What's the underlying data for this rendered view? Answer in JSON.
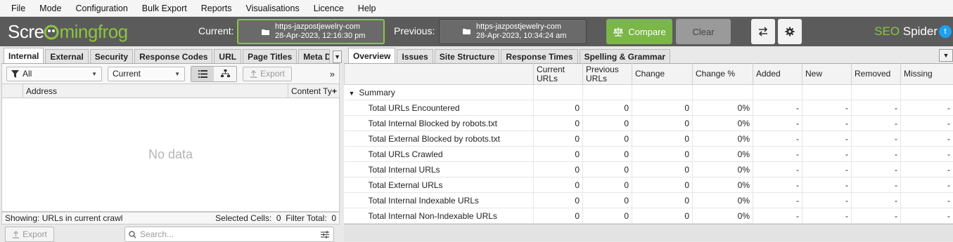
{
  "menu": [
    "File",
    "Mode",
    "Configuration",
    "Bulk Export",
    "Reports",
    "Visualisations",
    "Licence",
    "Help"
  ],
  "logo": {
    "part1": "Scre",
    "part2": "mingfrog"
  },
  "current_label": "Current:",
  "previous_label": "Previous:",
  "current_crawl": {
    "url": "https-jazpostjewelry-com",
    "date": "28-Apr-2023, 12:16:30 pm"
  },
  "previous_crawl": {
    "url": "https-jazpostjewelry-com",
    "date": "28-Apr-2023, 10:34:24 am"
  },
  "compare_label": "Compare",
  "clear_label": "Clear",
  "app_title": {
    "seo": "SEO",
    "spider": "Spider"
  },
  "left_tabs": [
    "Internal",
    "External",
    "Security",
    "Response Codes",
    "URL",
    "Page Titles",
    "Meta Descri"
  ],
  "filter": {
    "all": "All",
    "mode": "Current",
    "export": "Export"
  },
  "grid": {
    "address_col": "Address",
    "content_type_col": "Content Ty",
    "empty": "No data"
  },
  "status": {
    "showing": "Showing: URLs in current crawl",
    "selected": "Selected Cells:  0  Filter Total:  0"
  },
  "bottom": {
    "export": "Export",
    "search_placeholder": "Search..."
  },
  "right_tabs": [
    "Overview",
    "Issues",
    "Site Structure",
    "Response Times",
    "Spelling & Grammar"
  ],
  "columns": [
    "",
    "Current URLs",
    "Previous URLs",
    "Change",
    "Change %",
    "Added",
    "New",
    "Removed",
    "Missing"
  ],
  "summary_group": "Summary",
  "rows": [
    {
      "label": "Total URLs Encountered",
      "current": "0",
      "previous": "0",
      "change": "0",
      "change_pct": "0%",
      "added": "-",
      "new": "-",
      "removed": "-",
      "missing": "-"
    },
    {
      "label": "Total Internal Blocked by robots.txt",
      "current": "0",
      "previous": "0",
      "change": "0",
      "change_pct": "0%",
      "added": "-",
      "new": "-",
      "removed": "-",
      "missing": "-"
    },
    {
      "label": "Total External Blocked by robots.txt",
      "current": "0",
      "previous": "0",
      "change": "0",
      "change_pct": "0%",
      "added": "-",
      "new": "-",
      "removed": "-",
      "missing": "-"
    },
    {
      "label": "Total URLs Crawled",
      "current": "0",
      "previous": "0",
      "change": "0",
      "change_pct": "0%",
      "added": "-",
      "new": "-",
      "removed": "-",
      "missing": "-"
    },
    {
      "label": "Total Internal URLs",
      "current": "0",
      "previous": "0",
      "change": "0",
      "change_pct": "0%",
      "added": "-",
      "new": "-",
      "removed": "-",
      "missing": "-"
    },
    {
      "label": "Total External URLs",
      "current": "0",
      "previous": "0",
      "change": "0",
      "change_pct": "0%",
      "added": "-",
      "new": "-",
      "removed": "-",
      "missing": "-"
    },
    {
      "label": "Total Internal Indexable URLs",
      "current": "0",
      "previous": "0",
      "change": "0",
      "change_pct": "0%",
      "added": "-",
      "new": "-",
      "removed": "-",
      "missing": "-"
    },
    {
      "label": "Total Internal Non-Indexable URLs",
      "current": "0",
      "previous": "0",
      "change": "0",
      "change_pct": "0%",
      "added": "-",
      "new": "-",
      "removed": "-",
      "missing": "-"
    }
  ],
  "colors": {
    "brand_green": "#8cc63f",
    "compare_green": "#7ab648",
    "topbar": "#5b5b5b",
    "twitter": "#1da1f2"
  }
}
